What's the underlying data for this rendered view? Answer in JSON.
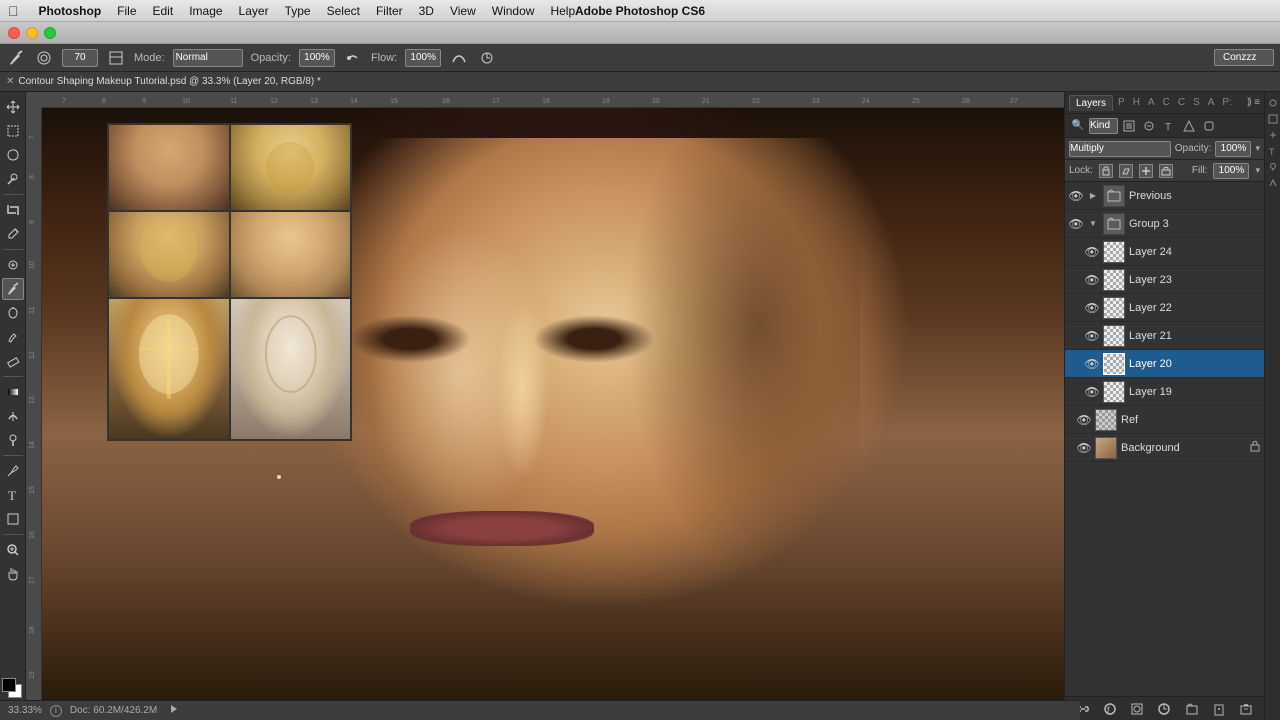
{
  "app": {
    "name": "Photoshop",
    "full_title": "Adobe Photoshop CS6",
    "menu_items": [
      "File",
      "Edit",
      "Image",
      "Layer",
      "Type",
      "Select",
      "Filter",
      "3D",
      "View",
      "Window",
      "Help"
    ]
  },
  "window": {
    "title": "Adobe Photoshop CS6",
    "document_tab": "Contour Shaping Makeup Tutorial.psd @ 33.3% (Layer 20, RGB/8) *"
  },
  "options_bar": {
    "brush_size": "70",
    "mode_label": "Mode:",
    "mode_value": "Normal",
    "opacity_label": "Opacity:",
    "opacity_value": "100%",
    "flow_label": "Flow:",
    "flow_value": "100%",
    "preset_label": "Conzzz"
  },
  "layers_panel": {
    "title": "Layers",
    "tabs": [
      "Layers",
      "P",
      "H",
      "A",
      "C",
      "C",
      "S",
      "A",
      "P:"
    ],
    "search_kind": "Kind",
    "blend_mode": "Multiply",
    "opacity_label": "Opacity:",
    "opacity_value": "100%",
    "lock_label": "Lock:",
    "fill_label": "Fill:",
    "fill_value": "100%",
    "layers": [
      {
        "name": "Previous",
        "type": "group",
        "visible": true,
        "collapsed": true,
        "indent": 0
      },
      {
        "name": "Group 3",
        "type": "group",
        "visible": true,
        "collapsed": false,
        "indent": 1
      },
      {
        "name": "Layer 24",
        "type": "layer",
        "visible": true,
        "indent": 2
      },
      {
        "name": "Layer 23",
        "type": "layer",
        "visible": true,
        "indent": 2
      },
      {
        "name": "Layer 22",
        "type": "layer",
        "visible": true,
        "indent": 2
      },
      {
        "name": "Layer 21",
        "type": "layer",
        "visible": true,
        "indent": 2
      },
      {
        "name": "Layer 20",
        "type": "layer",
        "visible": true,
        "active": true,
        "indent": 2
      },
      {
        "name": "Layer 19",
        "type": "layer",
        "visible": true,
        "indent": 2
      },
      {
        "name": "Ref",
        "type": "layer",
        "visible": true,
        "indent": 1
      },
      {
        "name": "Background",
        "type": "layer",
        "visible": true,
        "locked": true,
        "indent": 1
      }
    ]
  },
  "status_bar": {
    "zoom": "33.33%",
    "doc_info": "Doc: 60.2M/426.2M"
  },
  "toolbar": {
    "tools": [
      "move",
      "lasso",
      "brush",
      "stamp",
      "eraser",
      "blur",
      "pen",
      "text",
      "shape",
      "zoom",
      "color"
    ],
    "fg_color": "#000000",
    "bg_color": "#ffffff"
  }
}
